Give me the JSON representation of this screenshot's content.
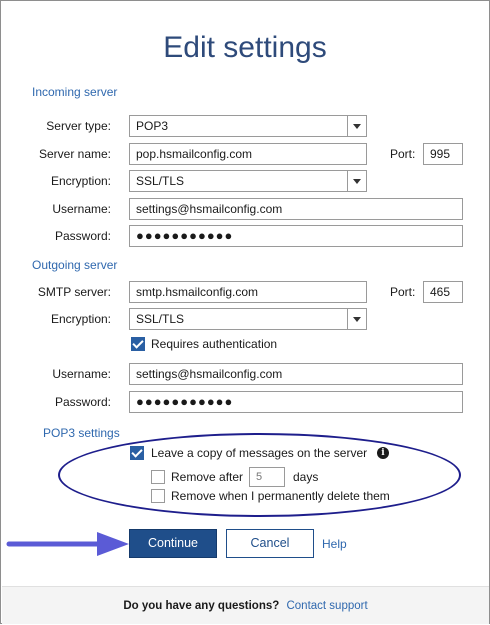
{
  "title": "Edit settings",
  "incoming": {
    "section_label": "Incoming server",
    "server_type_label": "Server type:",
    "server_type_value": "POP3",
    "server_name_label": "Server name:",
    "server_name_value": "pop.hsmailconfig.com",
    "port_label": "Port:",
    "port_value": "995",
    "encryption_label": "Encryption:",
    "encryption_value": "SSL/TLS",
    "username_label": "Username:",
    "username_value": "settings@hsmailconfig.com",
    "password_label": "Password:",
    "password_value": "●●●●●●●●●●●"
  },
  "outgoing": {
    "section_label": "Outgoing server",
    "smtp_label": "SMTP server:",
    "smtp_value": "smtp.hsmailconfig.com",
    "port_label": "Port:",
    "port_value": "465",
    "encryption_label": "Encryption:",
    "encryption_value": "SSL/TLS",
    "requires_auth_label": "Requires authentication",
    "username_label": "Username:",
    "username_value": "settings@hsmailconfig.com",
    "password_label": "Password:",
    "password_value": "●●●●●●●●●●●"
  },
  "pop3": {
    "section_label": "POP3 settings",
    "leave_copy_label": "Leave a copy of messages on the server",
    "remove_after_label": "Remove after",
    "remove_after_value": "5",
    "days_label": "days",
    "remove_when_deleted_label": "Remove when I permanently delete them"
  },
  "buttons": {
    "continue_label": "Continue",
    "cancel_label": "Cancel",
    "help_label": "Help"
  },
  "footer": {
    "question": "Do you have any questions?",
    "contact_link": "Contact support"
  },
  "colors": {
    "accent": "#1f4e8a",
    "section": "#2f68ae",
    "annotation_oval": "#1e1e8c",
    "annotation_arrow": "#5b5bd6"
  }
}
